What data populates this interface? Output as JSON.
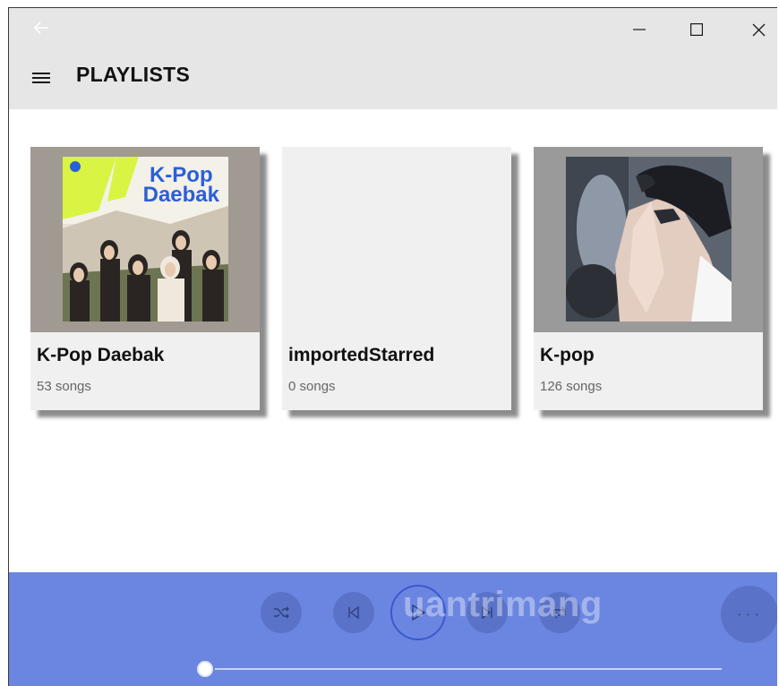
{
  "window": {
    "back_icon": "arrow-left-icon",
    "minimize_icon": "minimize-icon",
    "maximize_icon": "maximize-icon",
    "close_icon": "close-icon"
  },
  "header": {
    "title": "PLAYLISTS",
    "menu_icon": "hamburger-icon"
  },
  "playlists": [
    {
      "name": "K-Pop Daebak",
      "count": "53 songs",
      "cover_text_line1": "K-Pop",
      "cover_text_line2": "Daebak",
      "cover_colors": {
        "background": "#a19a93",
        "art_top": "#d9f442",
        "title": "#2b5fd9"
      }
    },
    {
      "name": "importedStarred",
      "count": "0 songs"
    },
    {
      "name": "K-pop",
      "count": "126 songs",
      "cover_colors": {
        "background": "#9a9a9a"
      }
    }
  ],
  "player": {
    "shuffle_icon": "shuffle-icon",
    "previous_icon": "previous-track-icon",
    "play_icon": "play-icon",
    "next_icon": "next-track-icon",
    "repeat_icon": "repeat-icon",
    "more_label": "···",
    "watermark": "uantrimang",
    "progress": 0.0,
    "colors": {
      "bar": "#6b86e0",
      "button": "#5a73c8"
    }
  }
}
